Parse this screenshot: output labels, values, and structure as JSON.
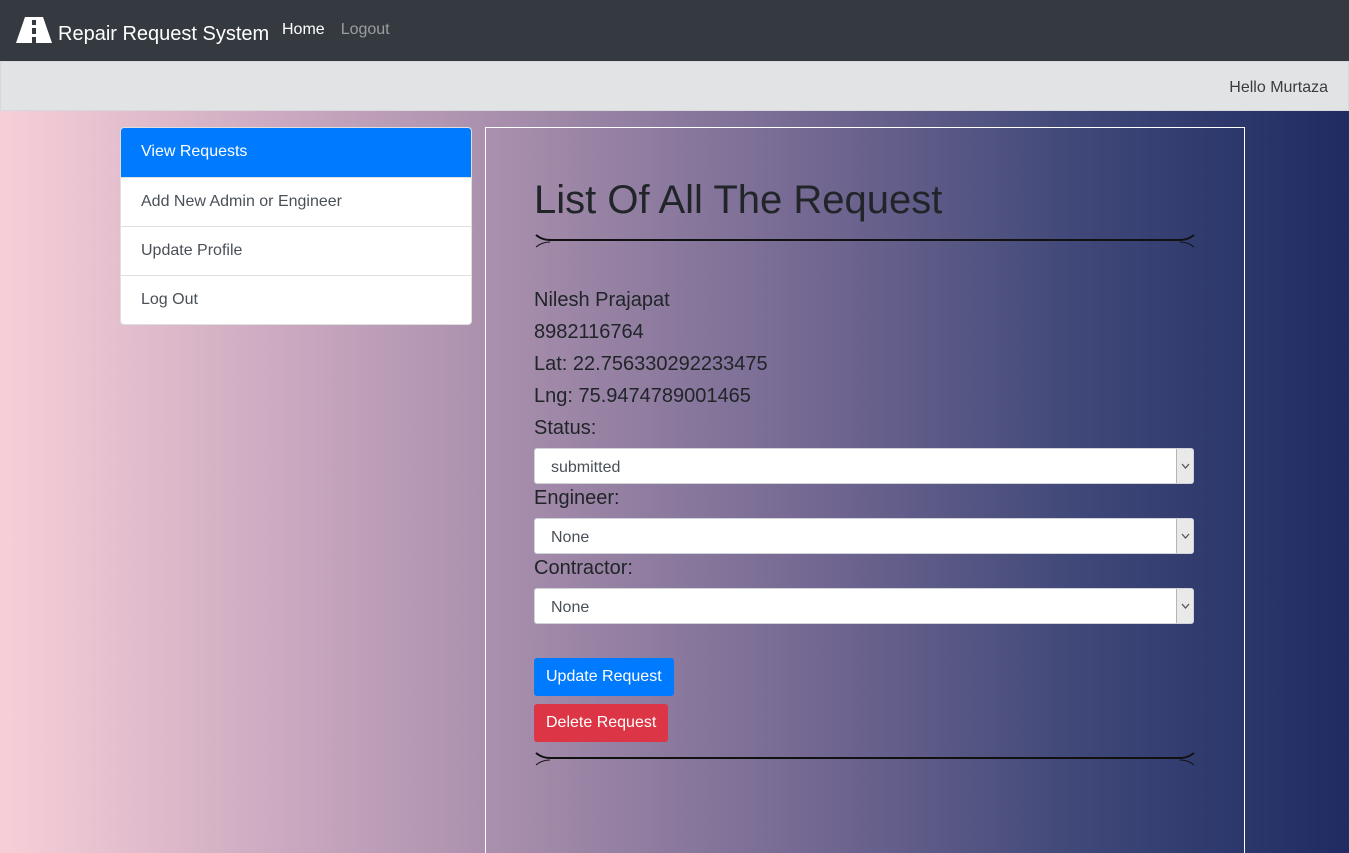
{
  "navbar": {
    "brand_icon": "road-icon",
    "brand_text": "Repair Request System",
    "links": [
      {
        "label": "Home",
        "active": true
      },
      {
        "label": "Logout",
        "active": false
      }
    ]
  },
  "greeting": "Hello Murtaza",
  "sidebar": {
    "items": [
      {
        "label": "View Requests",
        "active": true
      },
      {
        "label": "Add New Admin or Engineer",
        "active": false
      },
      {
        "label": "Update Profile",
        "active": false
      },
      {
        "label": "Log Out",
        "active": false
      }
    ]
  },
  "main": {
    "title": "List Of All The Request",
    "request": {
      "name": "Nilesh Prajapat",
      "phone": "8982116764",
      "lat": "Lat: 22.756330292233475",
      "lng": "Lng: 75.9474789001465"
    },
    "fields": {
      "status_label": "Status:",
      "status_value": "submitted",
      "engineer_label": "Engineer:",
      "engineer_value": "None",
      "contractor_label": "Contractor:",
      "contractor_value": "None"
    },
    "buttons": {
      "update": "Update Request",
      "delete": "Delete Request"
    }
  },
  "colors": {
    "navbar": "#343a40",
    "primary": "#007bff",
    "danger": "#dc3545",
    "greeting_bar": "#e2e3e5"
  }
}
